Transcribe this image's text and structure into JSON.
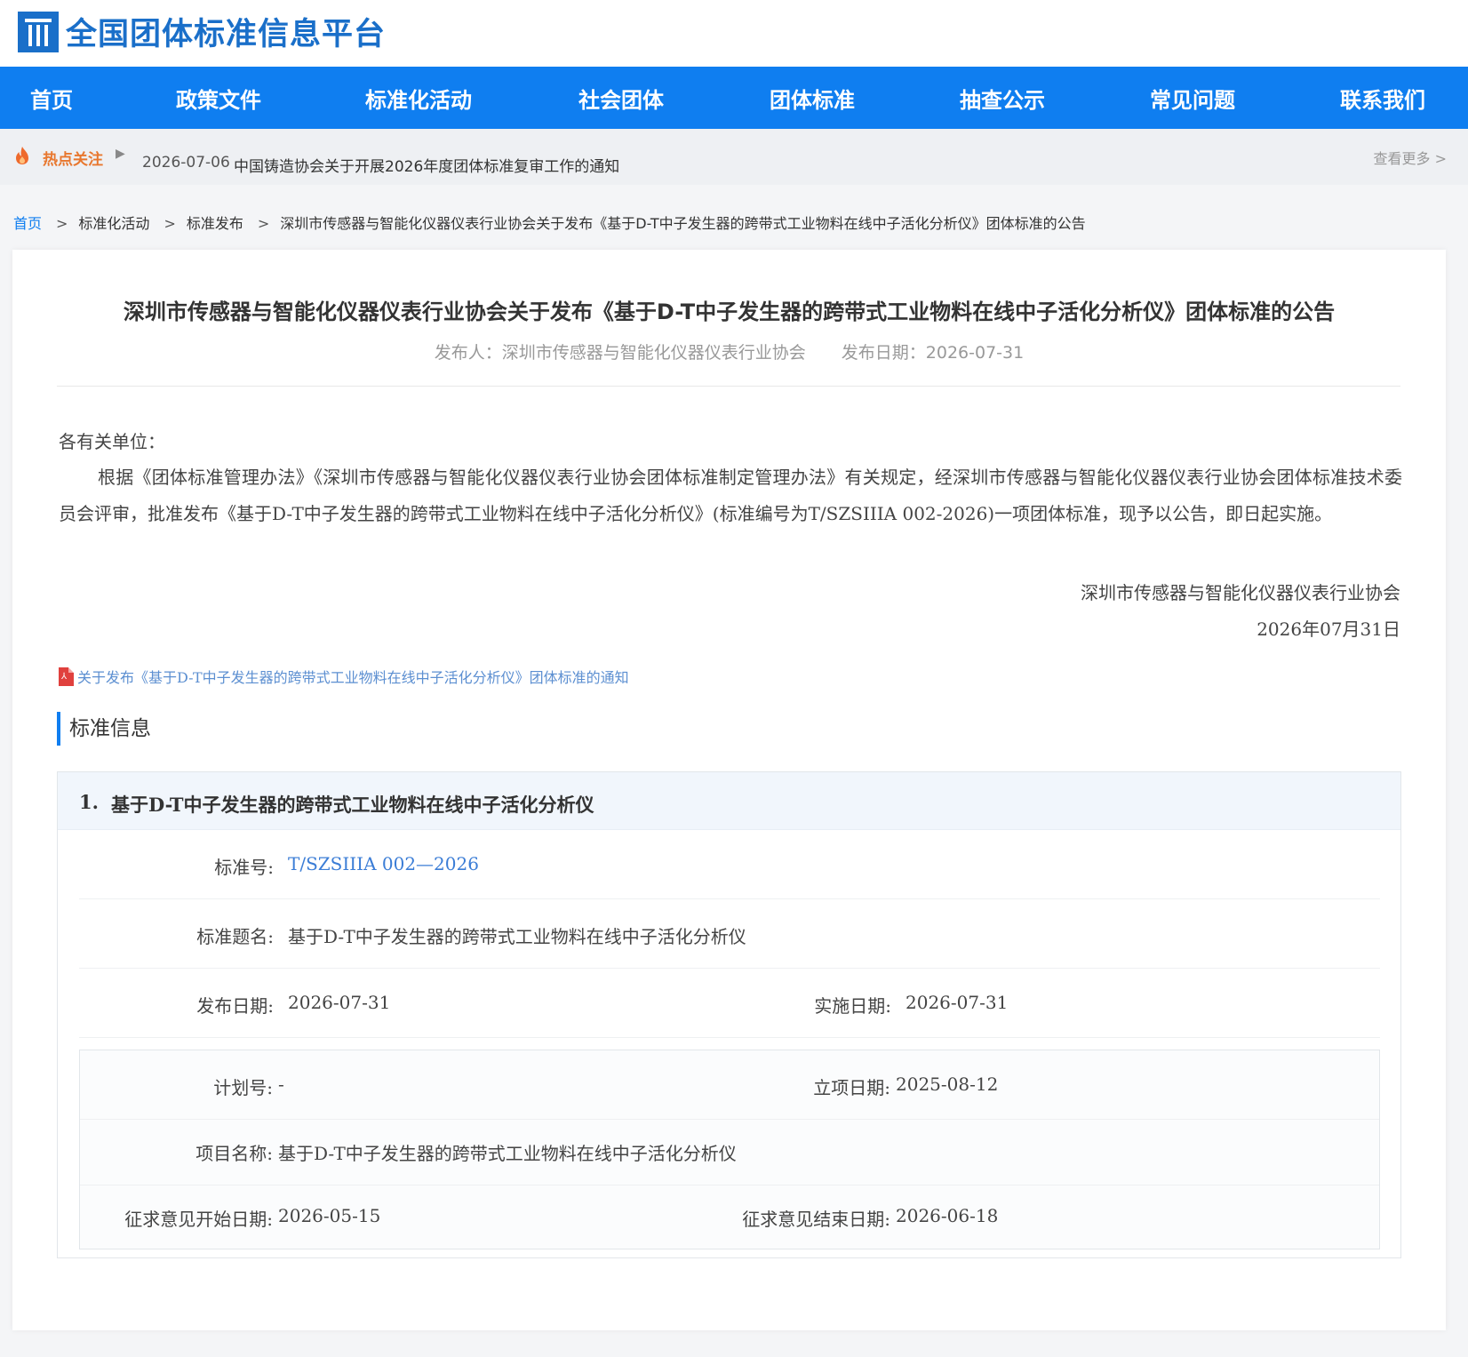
{
  "header": {
    "site_title": "全国团体标准信息平台",
    "logo_icon": "platform-logo-icon"
  },
  "nav": {
    "items": [
      "首页",
      "政策文件",
      "标准化活动",
      "社会团体",
      "团体标准",
      "抽查公示",
      "常见问题",
      "联系我们"
    ]
  },
  "hotbar": {
    "label": "热点关注",
    "icon": "flame-icon",
    "arrow": "▶",
    "date": "2026-07-06",
    "title": "中国铸造协会关于开展2026年度团体标准复审工作的通知",
    "more": "查看更多 >"
  },
  "breadcrumb": {
    "home": "首页",
    "separator": ">",
    "level1": "标准化活动",
    "level2": "标准发布",
    "current": "深圳市传感器与智能化仪器仪表行业协会关于发布《基于D-T中子发生器的跨带式工业物料在线中子活化分析仪》团体标准的公告"
  },
  "article": {
    "title": "深圳市传感器与智能化仪器仪表行业协会关于发布《基于D-T中子发生器的跨带式工业物料在线中子活化分析仪》团体标准的公告",
    "publisher": "发布人：深圳市传感器与智能化仪器仪表行业协会",
    "publish_date": "发布日期：2026-07-31",
    "salutation": "各有关单位：",
    "paragraph": "根据《团体标准管理办法》《深圳市传感器与智能化仪器仪表行业协会团体标准制定管理办法》有关规定，经深圳市传感器与智能化仪器仪表行业协会团体标准技术委员会评审，批准发布《基于D-T中子发生器的跨带式工业物料在线中子活化分析仪》(标准编号为T/SZSIIIA  002-2026)一项团体标准，现予以公告，即日起实施。",
    "signature_org": "深圳市传感器与智能化仪器仪表行业协会",
    "signature_date": "2026年07月31日",
    "attachment": "关于发布《基于D-T中子发生器的跨带式工业物料在线中子活化分析仪》团体标准的通知",
    "attachment_icon": "pdf-file-icon"
  },
  "standard_info": {
    "section_title": "标准信息",
    "items": [
      {
        "number_label": "1.",
        "name": "基于D-T中子发生器的跨带式工业物料在线中子活化分析仪",
        "std_no_label": "标准号:",
        "std_no": "T/SZSIIIA 002—2026",
        "std_title_label": "标准题名:",
        "std_title": "基于D-T中子发生器的跨带式工业物料在线中子活化分析仪",
        "release_label": "发布日期:",
        "release_date": "2026-07-31",
        "impl_label": "实施日期:",
        "impl_date": "2026-07-31",
        "plan_label": "计划号:",
        "plan_no": "-",
        "approval_label": "立项日期:",
        "approval_date": "2025-08-12",
        "project_label": "项目名称:",
        "project_name": "基于D-T中子发生器的跨带式工业物料在线中子活化分析仪",
        "comment_start_label": "征求意见开始日期:",
        "comment_start": "2026-05-15",
        "comment_end_label": "征求意见结束日期:",
        "comment_end": "2026-06-18"
      }
    ]
  },
  "colors": {
    "brand_blue": "#0f7ef0",
    "logo_blue": "#1a6fc9",
    "hot_orange": "#e8772e",
    "link_blue": "#3b7dd6"
  }
}
